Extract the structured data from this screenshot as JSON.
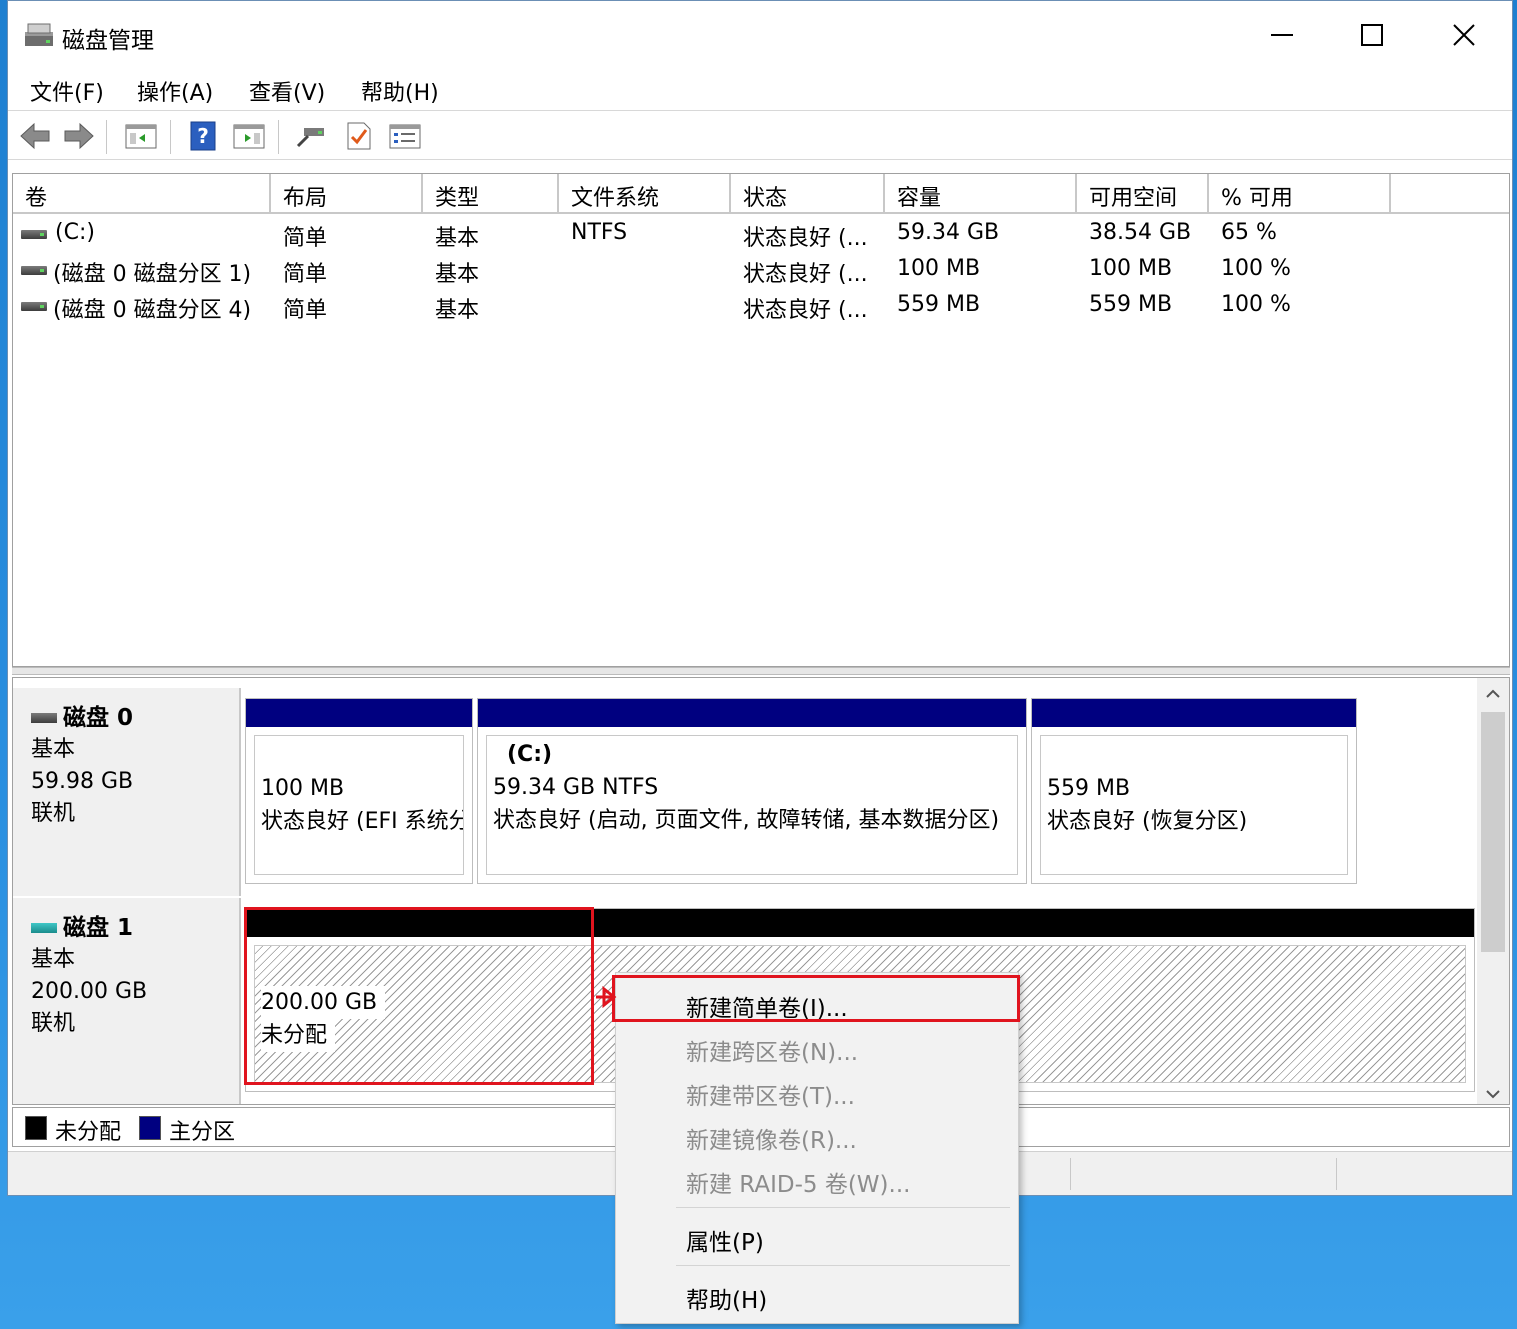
{
  "window": {
    "title": "磁盘管理"
  },
  "menu": [
    "文件(F)",
    "操作(A)",
    "查看(V)",
    "帮助(H)"
  ],
  "toolbar": [
    "back-icon",
    "forward-icon",
    "console-tree-icon",
    "help-icon",
    "action-pane-icon",
    "connect-icon",
    "check-icon",
    "properties-icon"
  ],
  "columns": [
    "卷",
    "布局",
    "类型",
    "文件系统",
    "状态",
    "容量",
    "可用空间",
    "% 可用"
  ],
  "volumes": [
    {
      "name": " (C:)",
      "layout": "简单",
      "type": "基本",
      "fs": "NTFS",
      "status": "状态良好 (...",
      "capacity": "59.34 GB",
      "free": "38.54 GB",
      "pct": "65 %"
    },
    {
      "name": "(磁盘 0 磁盘分区 1)",
      "layout": "简单",
      "type": "基本",
      "fs": "",
      "status": "状态良好 (...",
      "capacity": "100 MB",
      "free": "100 MB",
      "pct": "100 %"
    },
    {
      "name": "(磁盘 0 磁盘分区 4)",
      "layout": "简单",
      "type": "基本",
      "fs": "",
      "status": "状态良好 (...",
      "capacity": "559 MB",
      "free": "559 MB",
      "pct": "100 %"
    }
  ],
  "disks": [
    {
      "name": "磁盘 0",
      "kind": "基本",
      "size": "59.98 GB",
      "state": "联机",
      "partitions": [
        {
          "title": "",
          "line1": "100 MB",
          "line2": "状态良好 (EFI 系统分区)"
        },
        {
          "title": "(C:)",
          "line1": "59.34 GB NTFS",
          "line2": "状态良好 (启动, 页面文件, 故障转储, 基本数据分区)"
        },
        {
          "title": "",
          "line1": "559 MB",
          "line2": "状态良好 (恢复分区)"
        }
      ]
    },
    {
      "name": "磁盘 1",
      "kind": "基本",
      "size": "200.00 GB",
      "state": "联机",
      "partitions": [
        {
          "line1": "200.00 GB",
          "line2": "未分配"
        }
      ]
    }
  ],
  "legend": [
    "未分配",
    "主分区"
  ],
  "colors": {
    "primary": "#000080",
    "unallocated": "#000000",
    "highlight": "#e0141e"
  },
  "context_menu": {
    "items": [
      {
        "label": "新建简单卷(I)...",
        "enabled": true
      },
      {
        "label": "新建跨区卷(N)...",
        "enabled": false
      },
      {
        "label": "新建带区卷(T)...",
        "enabled": false
      },
      {
        "label": "新建镜像卷(R)...",
        "enabled": false
      },
      {
        "label": "新建 RAID-5 卷(W)...",
        "enabled": false
      },
      {
        "label": "属性(P)",
        "enabled": true
      },
      {
        "label": "帮助(H)",
        "enabled": true
      }
    ]
  }
}
